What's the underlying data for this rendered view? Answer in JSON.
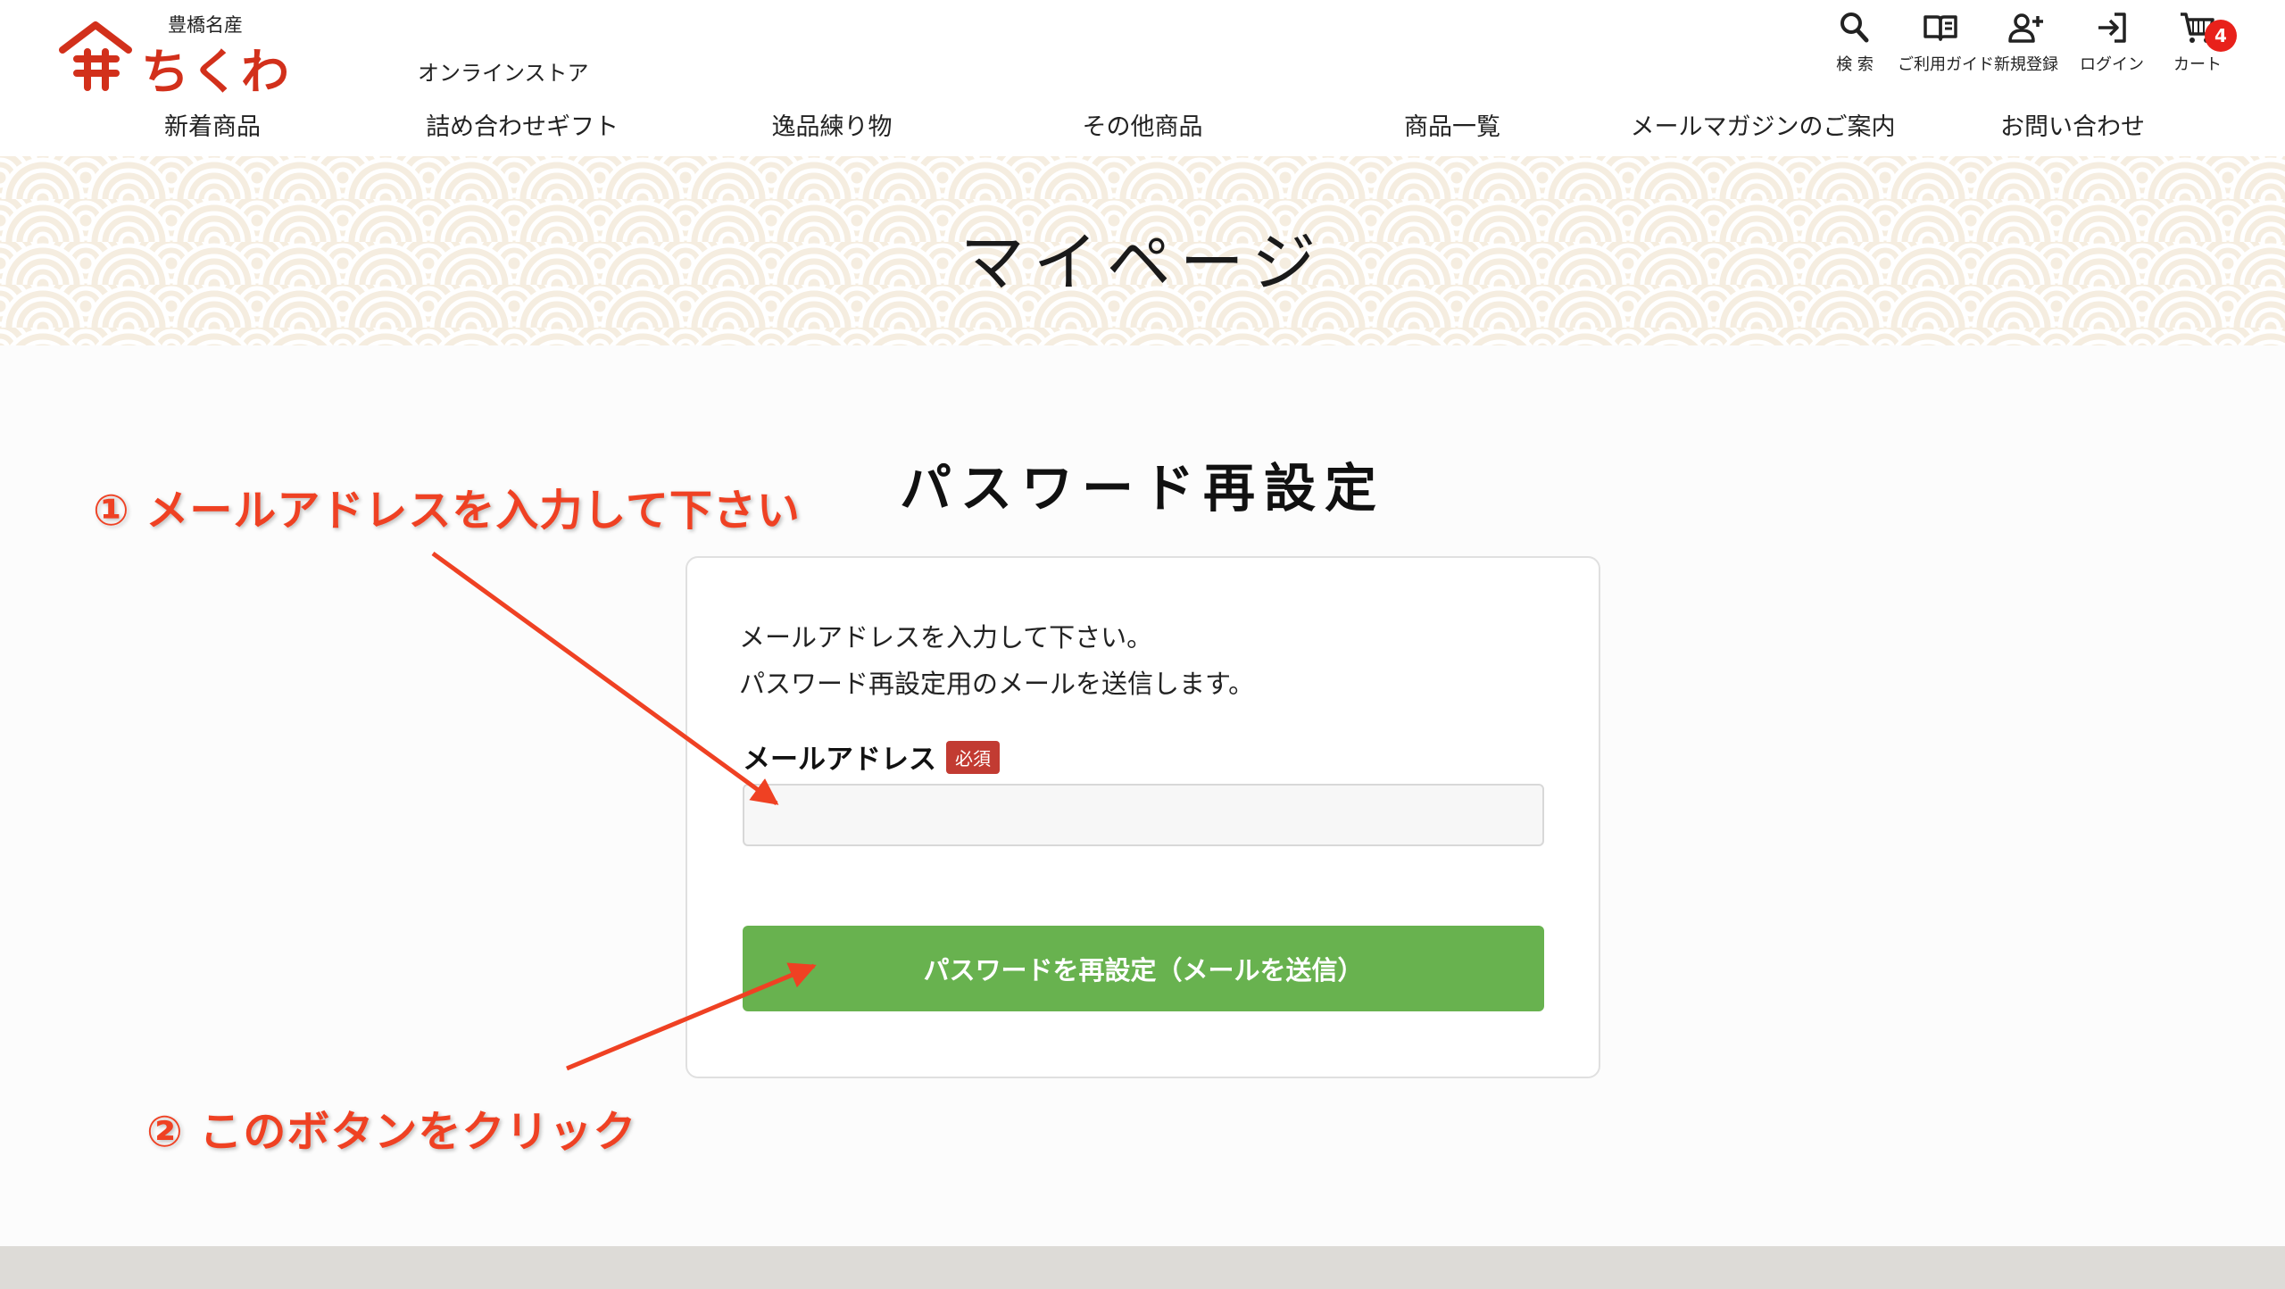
{
  "header": {
    "logo": {
      "sub": "豊橋名産",
      "main": "ちくわ",
      "store": "オンラインストア",
      "brand_color": "#d2301b"
    },
    "utility": [
      {
        "label": "検 索",
        "icon": "search-icon"
      },
      {
        "label": "ご利用ガイド",
        "icon": "guide-book-icon"
      },
      {
        "label": "新規登録",
        "icon": "user-plus-icon"
      },
      {
        "label": "ログイン",
        "icon": "login-icon"
      },
      {
        "label": "カート",
        "icon": "cart-icon"
      }
    ],
    "cart_count": "4",
    "nav": [
      "新着商品",
      "詰め合わせギフト",
      "逸品練り物",
      "その他商品",
      "商品一覧",
      "メールマガジンのご案内",
      "お問い合わせ"
    ]
  },
  "hero": {
    "title": "マイページ"
  },
  "main": {
    "title": "パスワード再設定",
    "description_line1": "メールアドレスを入力して下さい。",
    "description_line2": "パスワード再設定用のメールを送信します。",
    "email_label": "メールアドレス",
    "required_badge": "必須",
    "email_value": "",
    "submit_label": "パスワードを再設定（メールを送信）",
    "accent_color": "#68b24f"
  },
  "annotations": {
    "step1": "① メールアドレスを入力して下さい",
    "step2": "② このボタンをクリック",
    "color": "#ef4123"
  }
}
